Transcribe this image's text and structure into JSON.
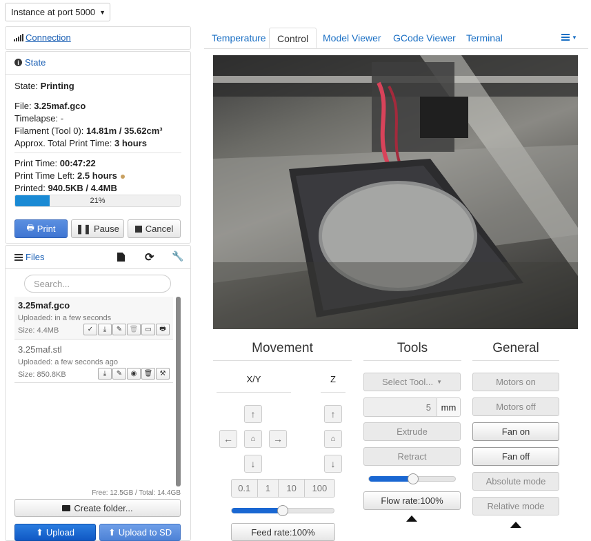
{
  "instance_select": {
    "value": "Instance at port 5000"
  },
  "connection": {
    "label": "Connection"
  },
  "state": {
    "title": "State",
    "state_label": "State:",
    "state_value": "Printing",
    "file_label": "File:",
    "file_value": "3.25maf.gco",
    "timelapse_label": "Timelapse:",
    "timelapse_value": "-",
    "filament_label": "Filament (Tool 0):",
    "filament_value": "14.81m / 35.62cm³",
    "approx_label": "Approx. Total Print Time:",
    "approx_value": "3 hours",
    "print_time_label": "Print Time:",
    "print_time_value": "00:47:22",
    "time_left_label": "Print Time Left:",
    "time_left_value": "2.5 hours",
    "printed_label": "Printed:",
    "printed_value": "940.5KB / 4.4MB",
    "progress_text": "21%",
    "progress_fraction": 0.21,
    "print_button": "Print",
    "pause_button": "Pause",
    "cancel_button": "Cancel"
  },
  "files": {
    "title": "Files",
    "search_placeholder": "Search...",
    "items": [
      {
        "name": "3.25maf.gco",
        "uploaded": "Uploaded: in a few seconds",
        "size": "Size: 4.4MB"
      },
      {
        "name": "3.25maf.stl",
        "uploaded": "Uploaded: a few seconds ago",
        "size": "Size: 850.8KB"
      }
    ],
    "free_total": "Free: 12.5GB / Total: 14.4GB",
    "create_folder": "Create folder...",
    "upload": "Upload",
    "upload_sd": "Upload to SD"
  },
  "tabs": [
    "Temperature",
    "Control",
    "Model Viewer",
    "GCode Viewer",
    "Terminal"
  ],
  "movement": {
    "title": "Movement",
    "xy_label": "X/Y",
    "z_label": "Z",
    "steps": [
      "0.1",
      "1",
      "10",
      "100"
    ],
    "feed_rate": "Feed rate:100%",
    "feed_fraction": 0.49
  },
  "tools": {
    "title": "Tools",
    "select_tool": "Select Tool...",
    "amount": "5",
    "unit": "mm",
    "extrude": "Extrude",
    "retract": "Retract",
    "flow_rate": "Flow rate:100%",
    "flow_fraction": 0.5
  },
  "general": {
    "title": "General",
    "motors_on": "Motors on",
    "motors_off": "Motors off",
    "fan_on": "Fan on",
    "fan_off": "Fan off",
    "absolute_mode": "Absolute mode",
    "relative_mode": "Relative mode"
  },
  "colors": {
    "accent": "#1a67d2",
    "link": "#1a6fc4",
    "primary_button": "#3f75d2"
  }
}
